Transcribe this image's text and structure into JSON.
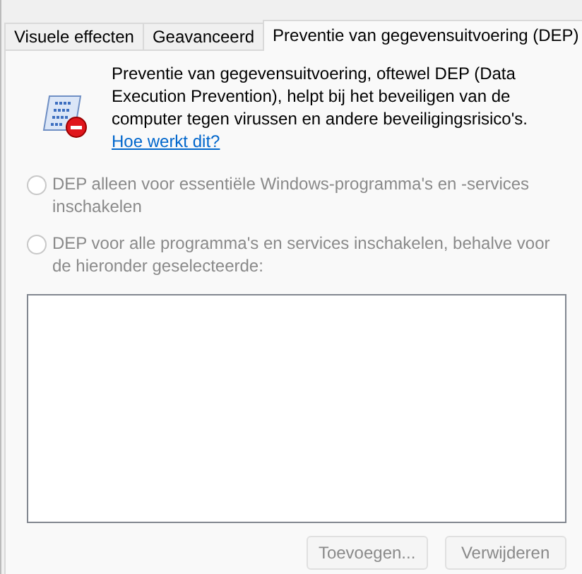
{
  "tabs": [
    {
      "label": "Visuele effecten",
      "selected": false
    },
    {
      "label": "Geavanceerd",
      "selected": false
    },
    {
      "label": "Preventie van gegevensuitvoering (DEP)",
      "selected": true
    }
  ],
  "intro": {
    "text": "Preventie van gegevensuitvoering, oftewel DEP (Data Execution Prevention), helpt bij het beveiligen van de computer tegen virussen en andere beveiligingsrisico's.",
    "link": "Hoe werkt dit?"
  },
  "options": [
    {
      "label": "DEP alleen voor essentiële Windows-programma's en -services inschakelen",
      "selected": false,
      "disabled": true
    },
    {
      "label": "DEP voor alle programma's en services inschakelen, behalve voor de hieronder geselecteerde:",
      "selected": false,
      "disabled": true
    }
  ],
  "buttons": [
    {
      "label": "Toevoegen...",
      "disabled": true
    },
    {
      "label": "Verwijderen",
      "disabled": true
    }
  ]
}
